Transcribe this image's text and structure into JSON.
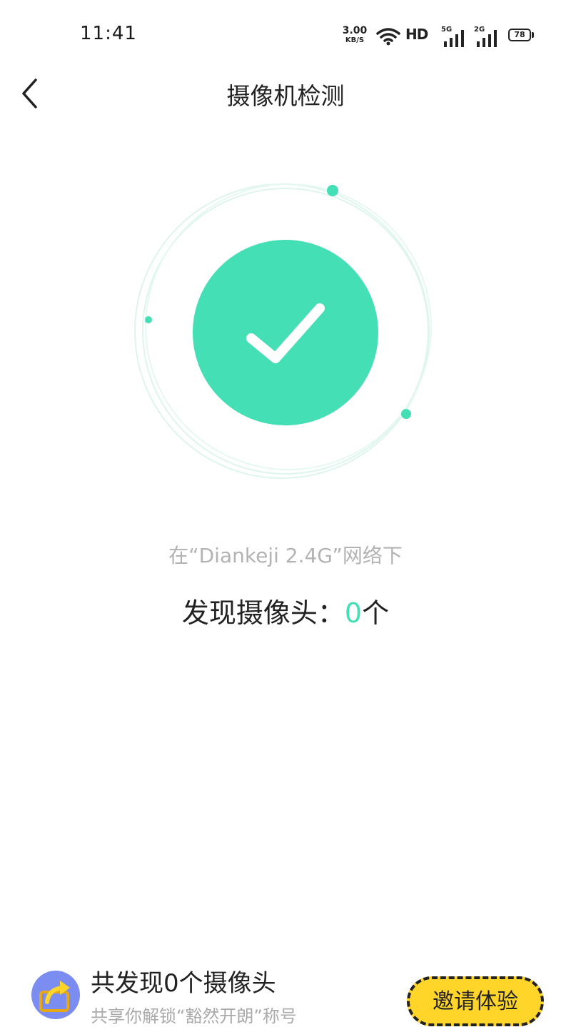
{
  "status_bar": {
    "time": "11:41",
    "net_speed_value": "3.00",
    "net_speed_unit": "KB/S",
    "hd_label": "HD",
    "sim1_generation": "5G",
    "sim2_generation": "2G",
    "battery_level": "78"
  },
  "nav": {
    "back_icon": "chevron-left-icon",
    "title": "摄像机检测"
  },
  "scan": {
    "status_icon": "check-icon",
    "accent_color": "#44dfb5",
    "network_text": "在“Diankeji 2.4G”网络下",
    "found_prefix": "发现摄像头：",
    "found_count": "0",
    "found_suffix": "个"
  },
  "footer": {
    "share_icon": "share-icon",
    "title": "共发现0个摄像头",
    "subtitle": "共享你解锁“豁然开朗”称号",
    "invite_button": "邀请体验",
    "invite_button_color": "#ffd52a"
  }
}
